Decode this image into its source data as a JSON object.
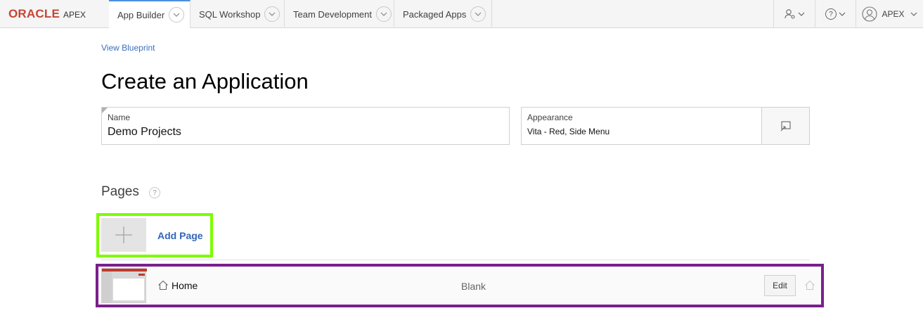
{
  "header": {
    "brand": "ORACLE",
    "product": "APEX",
    "tabs": [
      {
        "label": "App Builder"
      },
      {
        "label": "SQL Workshop"
      },
      {
        "label": "Team Development"
      },
      {
        "label": "Packaged Apps"
      }
    ],
    "user_label": "APEX",
    "accent": "#4a90e2"
  },
  "main": {
    "view_blueprint": "View Blueprint",
    "title": "Create an Application",
    "name_field": {
      "label": "Name",
      "value": "Demo Projects"
    },
    "appearance_field": {
      "label": "Appearance",
      "value": "Vita - Red, Side Menu"
    },
    "pages_label": "Pages",
    "help_glyph": "?",
    "add_page_label": "Add Page",
    "pages": [
      {
        "name": "Home",
        "type": "Blank",
        "edit_label": "Edit"
      }
    ],
    "highlight_colors": {
      "add_page": "#7cfc00",
      "page_row": "#7a1f8c"
    }
  }
}
